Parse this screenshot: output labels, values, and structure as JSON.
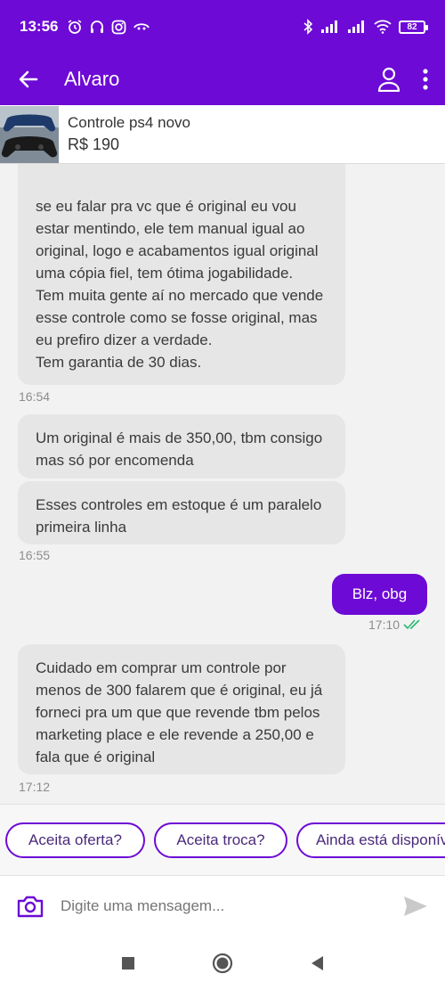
{
  "status_bar": {
    "time": "13:56",
    "battery": "82"
  },
  "appbar": {
    "title": "Alvaro",
    "icons": [
      "back-arrow-icon",
      "profile-icon",
      "more-vert-icon"
    ]
  },
  "product": {
    "name": "Controle ps4 novo",
    "price": "R$ 190"
  },
  "messages": [
    {
      "direction": "in",
      "text": "se eu falar pra vc que é original eu vou estar mentindo, ele tem manual igual ao original, logo e acabamentos igual original uma cópia fiel, tem ótima jogabilidade.\nTem muita gente aí no mercado que vende esse controle como se fosse original, mas eu prefiro dizer a verdade.\nTem garantia de 30 dias.",
      "time": "16:54"
    },
    {
      "direction": "in",
      "text": "Um original é mais de 350,00, tbm consigo mas só por encomenda",
      "time": ""
    },
    {
      "direction": "in",
      "text": "Esses controles em estoque é um paralelo primeira linha",
      "time": "16:55"
    },
    {
      "direction": "out",
      "text": "Blz, obg",
      "time": "17:10"
    },
    {
      "direction": "in",
      "text": "Cuidado em comprar um controle por menos de 300 falarem que é original, eu já forneci pra um que que revende tbm pelos marketing place e ele revende a 250,00 e fala que é original",
      "time": "17:12"
    }
  ],
  "suggestions": [
    "Aceita oferta?",
    "Aceita troca?",
    "Ainda está disponível?"
  ],
  "composer": {
    "placeholder": "Digite uma mensagem..."
  },
  "colors": {
    "brand": "#6d0ad6",
    "bubble_in": "#e6e6e6",
    "read_check": "#2bb673"
  }
}
